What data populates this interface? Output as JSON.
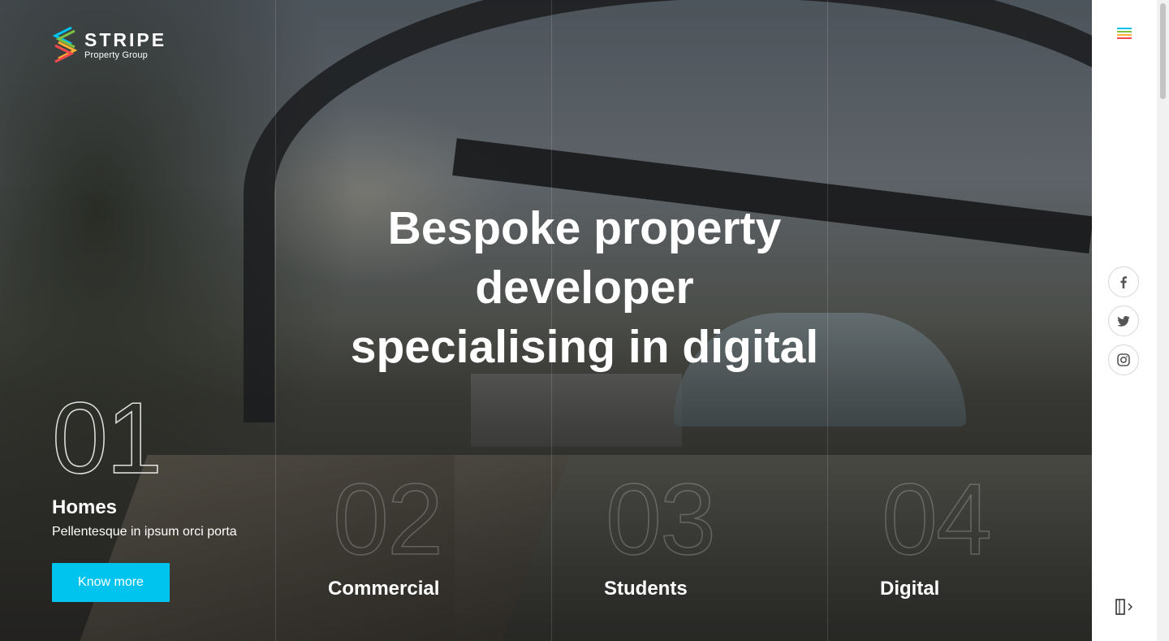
{
  "brand": {
    "name": "STRIPE",
    "subtitle": "Property Group",
    "colors": [
      "#f44a4a",
      "#fbb034",
      "#00c3ee",
      "#7bc043",
      "#9b59b6"
    ]
  },
  "hero": {
    "headline_line1": "Bespoke property developer",
    "headline_line2": "specialising in digital"
  },
  "panels": [
    {
      "number": "01",
      "title": "Homes",
      "description": "Pellentesque in ipsum orci porta",
      "button": "Know more",
      "active": true
    },
    {
      "number": "02",
      "title": "Commercial",
      "active": false
    },
    {
      "number": "03",
      "title": "Students",
      "active": false
    },
    {
      "number": "04",
      "title": "Digital",
      "active": false
    }
  ],
  "sidebar": {
    "menu_icon": "hamburger-menu-icon",
    "menu_colors": [
      "#00c3ee",
      "#7bc043",
      "#fbb034",
      "#f44a4a"
    ],
    "social": [
      "facebook-icon",
      "twitter-icon",
      "instagram-icon"
    ],
    "login_icon": "login-door-icon"
  },
  "accent_color": "#00c3ee"
}
